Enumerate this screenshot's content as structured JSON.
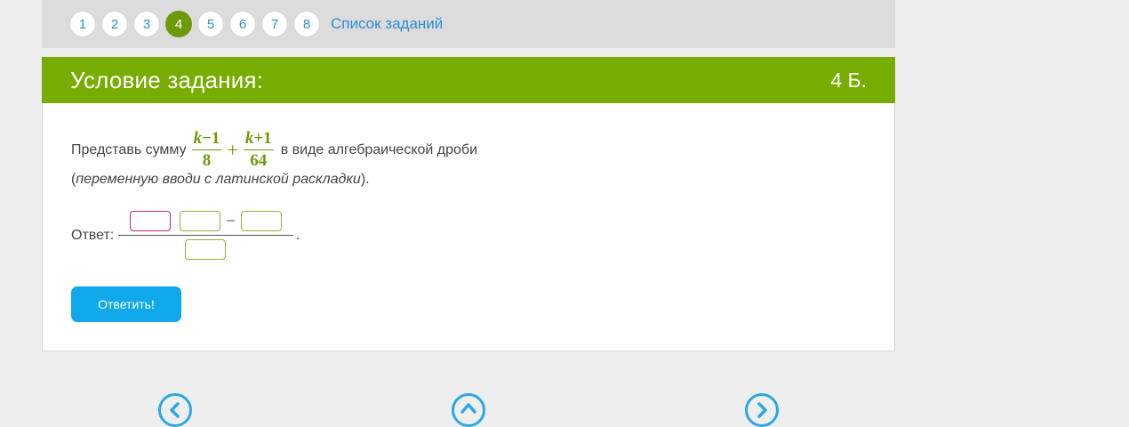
{
  "pager": {
    "pages": [
      "1",
      "2",
      "3",
      "4",
      "5",
      "6",
      "7",
      "8"
    ],
    "active_index": 3,
    "task_list_label": "Список заданий"
  },
  "task": {
    "header_title": "Условие задания:",
    "points": "4 Б.",
    "problem_prefix": "Представь сумму",
    "frac1_num_var": "k",
    "frac1_num_rest": "−1",
    "frac1_den": "8",
    "operator": "+",
    "frac2_num_var": "k",
    "frac2_num_rest": "+1",
    "frac2_den": "64",
    "problem_suffix": "в виде алгебраической дроби",
    "hint_open": "(",
    "hint_text": "переменную вводи с латинской раскладки",
    "hint_close": ").",
    "answer_label": "Ответ:",
    "answer_minus": "−",
    "answer_period": ".",
    "inputs": {
      "num_a": "",
      "num_b": "",
      "num_c": "",
      "den": ""
    },
    "submit_label": "Ответить!"
  },
  "nav_icons": [
    "prev-arrow-icon",
    "up-arrow-icon",
    "next-arrow-icon"
  ],
  "colors": {
    "accent_green": "#76ad00",
    "link_blue": "#2a8fd0",
    "button_blue": "#0fa8e8",
    "focus_pink": "#c0287c"
  }
}
